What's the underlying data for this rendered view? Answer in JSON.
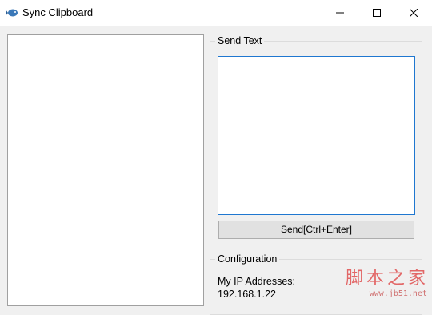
{
  "window": {
    "title": "Sync Clipboard",
    "icon": "fish-icon",
    "controls": [
      "minimize-icon",
      "maximize-icon",
      "close-icon"
    ]
  },
  "send_group": {
    "label": "Send Text",
    "text_value": "",
    "button_label": "Send[Ctrl+Enter]"
  },
  "config_group": {
    "label": "Configuration",
    "ip_label": "My IP Addresses:",
    "ip_value": "192.168.1.22"
  },
  "watermark": {
    "chinese": "脚本之家",
    "url": "www.jb51.net"
  },
  "colors": {
    "accent_border": "#1f77d0",
    "watermark": "#e05050"
  }
}
